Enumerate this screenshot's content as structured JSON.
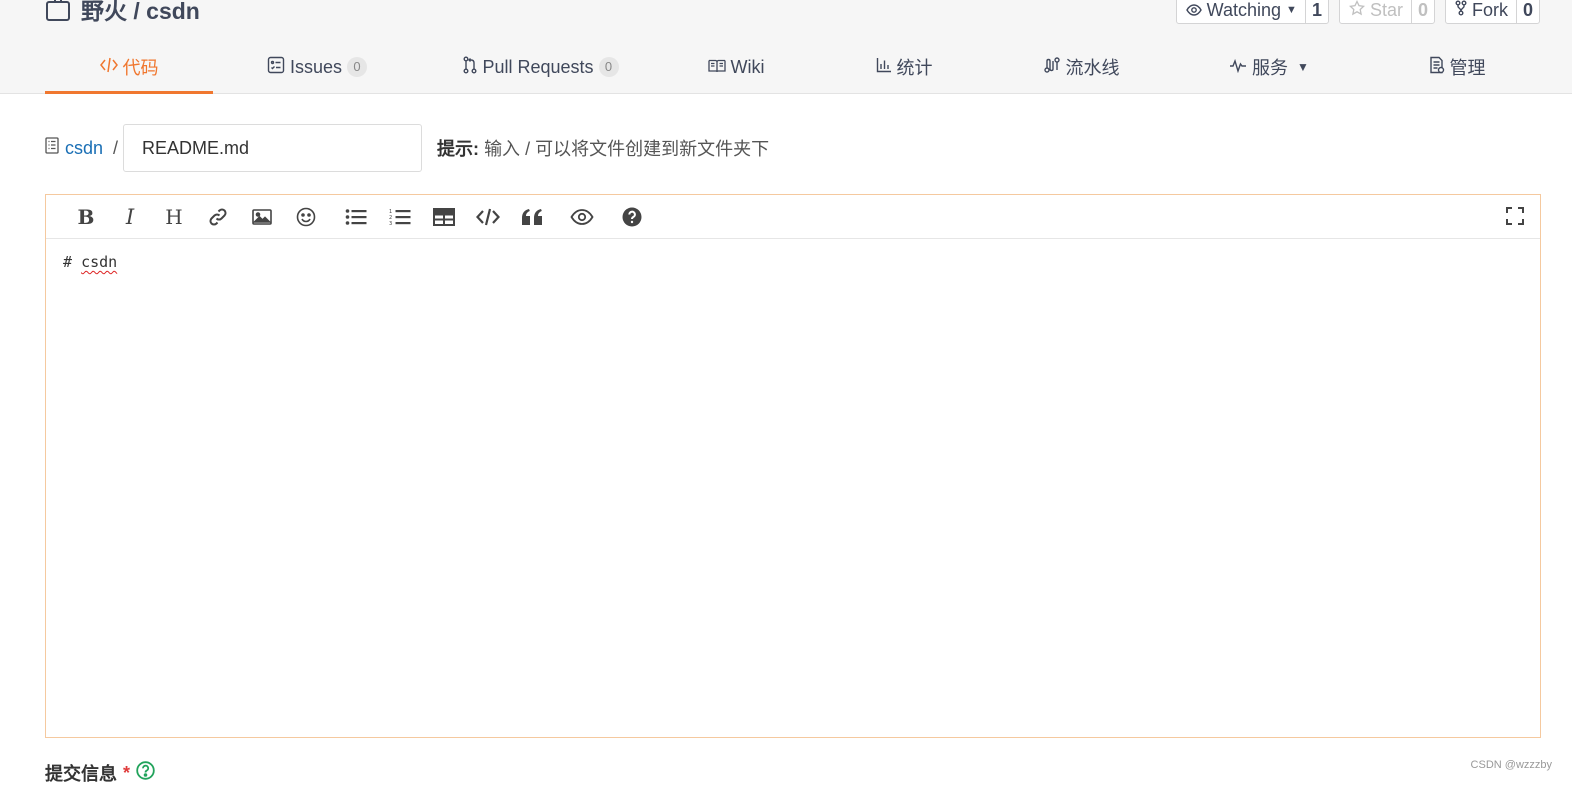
{
  "repo": {
    "title": "野火 / csdn"
  },
  "actions": {
    "watching": {
      "label": "Watching",
      "count": "1"
    },
    "star": {
      "label": "Star",
      "count": "0"
    },
    "fork": {
      "label": "Fork",
      "count": "0"
    }
  },
  "tabs": [
    {
      "label": "代码",
      "icon": "code-icon",
      "active": true
    },
    {
      "label": "Issues",
      "badge": "0",
      "icon": "issues-icon"
    },
    {
      "label": "Pull Requests",
      "badge": "0",
      "icon": "pull-request-icon"
    },
    {
      "label": "Wiki",
      "icon": "book-icon"
    },
    {
      "label": "统计",
      "icon": "bar-chart-icon"
    },
    {
      "label": "流水线",
      "icon": "pipeline-icon"
    },
    {
      "label": "服务",
      "icon": "pulse-icon"
    },
    {
      "label": "管理",
      "icon": "manage-icon"
    }
  ],
  "path": {
    "root": "csdn",
    "separator": "/",
    "filename_value": "README.md",
    "hint_label": "提示:",
    "hint_text": "输入 / 可以将文件创建到新文件夹下"
  },
  "editor": {
    "content_prefix": "# ",
    "content_word": "csdn",
    "toolbar": [
      "bold",
      "italic",
      "heading",
      "link",
      "image",
      "emoji",
      "unordered-list",
      "ordered-list",
      "table",
      "code",
      "quote",
      "preview",
      "help",
      "fullscreen"
    ]
  },
  "commit": {
    "label": "提交信息",
    "required_mark": "*"
  },
  "watermark": "CSDN @wzzzby",
  "colors": {
    "accent": "#f0772f",
    "link": "#1a6fb5",
    "editor_border": "#f5c99f",
    "help_green": "#21a35b"
  }
}
